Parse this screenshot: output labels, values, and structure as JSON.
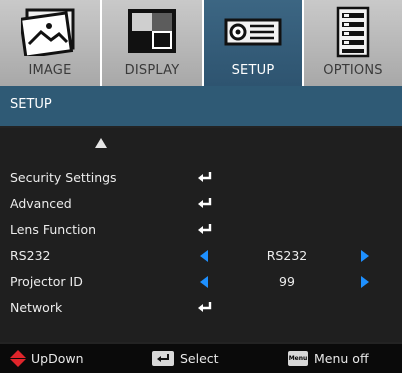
{
  "tabs": [
    {
      "label": "IMAGE",
      "icon": "image-icon",
      "active": false
    },
    {
      "label": "DISPLAY",
      "icon": "display-icon",
      "active": false
    },
    {
      "label": "SETUP",
      "icon": "projector-icon",
      "active": true
    },
    {
      "label": "OPTIONS",
      "icon": "options-list-icon",
      "active": false
    }
  ],
  "title": "SETUP",
  "menu": [
    {
      "label": "Security Settings",
      "type": "enter"
    },
    {
      "label": "Advanced",
      "type": "enter"
    },
    {
      "label": "Lens Function",
      "type": "enter"
    },
    {
      "label": "RS232",
      "type": "select",
      "value": "RS232"
    },
    {
      "label": "Projector ID",
      "type": "select",
      "value": "99"
    },
    {
      "label": "Network",
      "type": "enter"
    }
  ],
  "footer": {
    "updown": "UpDown",
    "select": "Select",
    "menu_key": "Menu",
    "menu_off": "Menu off"
  },
  "colors": {
    "accent": "#2f5a75",
    "arrow": "#1e90ff",
    "updown": "#e0252b"
  }
}
